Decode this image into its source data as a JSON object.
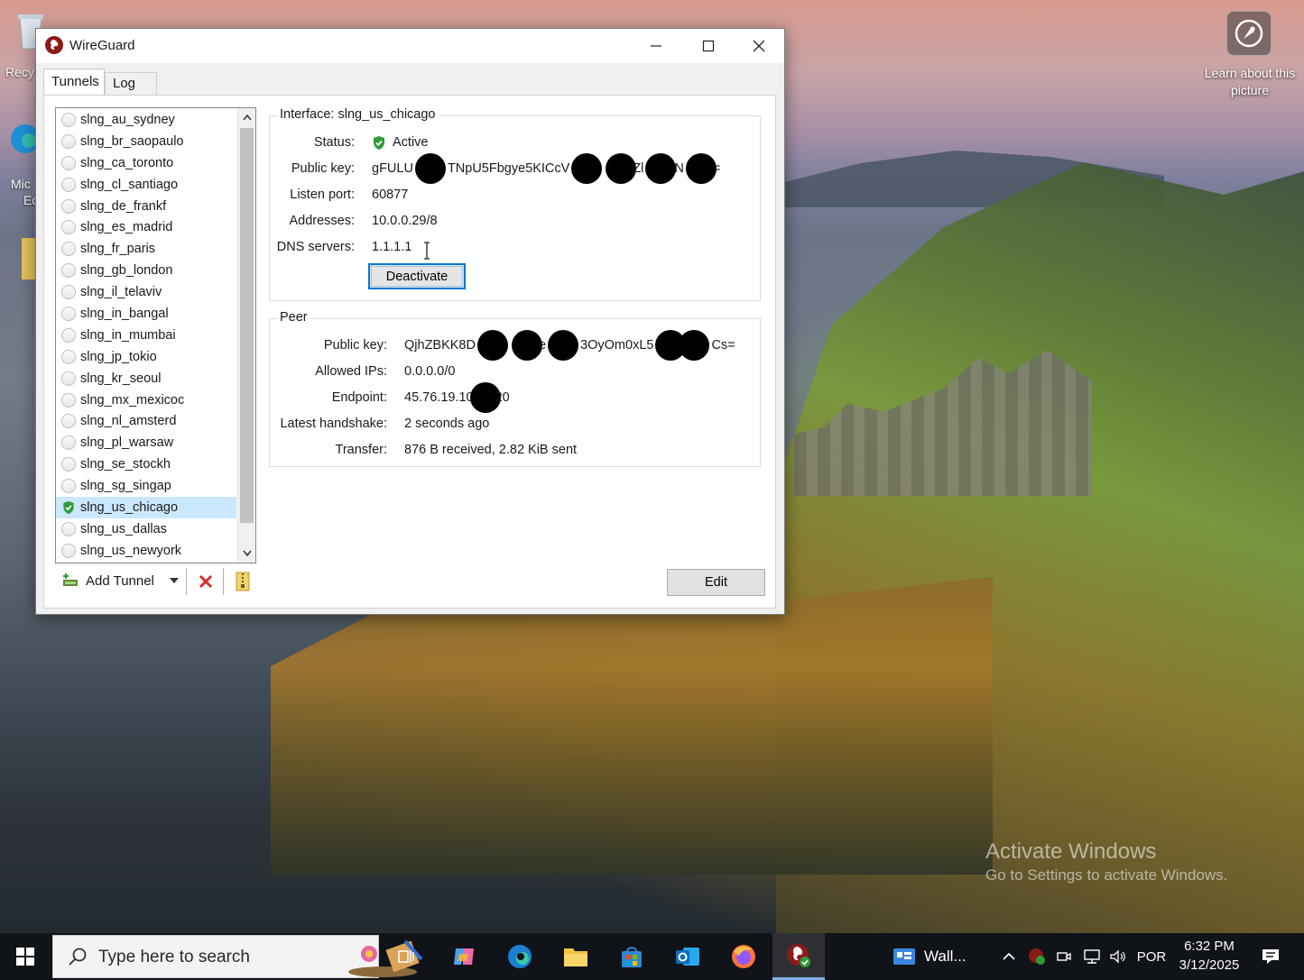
{
  "desktop": {
    "recycle_label": "Recy",
    "edge_label_1": "Mic",
    "edge_label_2": "Ed",
    "learn_about_label": "Learn about this picture",
    "activate_title": "Activate Windows",
    "activate_subtitle": "Go to Settings to activate Windows."
  },
  "window": {
    "title": "WireGuard",
    "tabs": [
      {
        "label": "Tunnels",
        "active": true
      },
      {
        "label": "Log",
        "active": false
      }
    ]
  },
  "tunnels": [
    {
      "name": "slng_au_sydney",
      "active": false
    },
    {
      "name": "slng_br_saopaulo",
      "active": false
    },
    {
      "name": "slng_ca_toronto",
      "active": false
    },
    {
      "name": "slng_cl_santiago",
      "active": false
    },
    {
      "name": "slng_de_frankf",
      "active": false
    },
    {
      "name": "slng_es_madrid",
      "active": false
    },
    {
      "name": "slng_fr_paris",
      "active": false
    },
    {
      "name": "slng_gb_london",
      "active": false
    },
    {
      "name": "slng_il_telaviv",
      "active": false
    },
    {
      "name": "slng_in_bangal",
      "active": false
    },
    {
      "name": "slng_in_mumbai",
      "active": false
    },
    {
      "name": "slng_jp_tokio",
      "active": false
    },
    {
      "name": "slng_kr_seoul",
      "active": false
    },
    {
      "name": "slng_mx_mexicoc",
      "active": false
    },
    {
      "name": "slng_nl_amsterd",
      "active": false
    },
    {
      "name": "slng_pl_warsaw",
      "active": false
    },
    {
      "name": "slng_se_stockh",
      "active": false
    },
    {
      "name": "slng_sg_singap",
      "active": false
    },
    {
      "name": "slng_us_chicago",
      "active": true
    },
    {
      "name": "slng_us_dallas",
      "active": false
    },
    {
      "name": "slng_us_newyork",
      "active": false
    }
  ],
  "toolbar": {
    "add_tunnel_label": "Add Tunnel"
  },
  "interface": {
    "group_title": "Interface: slng_us_chicago",
    "status_label": "Status:",
    "status_value": "Active",
    "public_key_label": "Public key:",
    "public_key_parts": [
      "gFULU",
      "TNpU5Fbgye5KICcV",
      "",
      "",
      "Zl",
      "N",
      "="
    ],
    "listen_port_label": "Listen port:",
    "listen_port_value": "60877",
    "addresses_label": "Addresses:",
    "addresses_value": "10.0.0.29/8",
    "dns_label": "DNS servers:",
    "dns_value": "1.1.1.1",
    "deactivate_label": "Deactivate"
  },
  "peer": {
    "group_title": "Peer",
    "public_key_label": "Public key:",
    "public_key_parts": [
      "QjhZBKK8D",
      "",
      "e",
      "3OyOm0xL5",
      "",
      "Cs="
    ],
    "allowed_ips_label": "Allowed IPs:",
    "allowed_ips_value": "0.0.0.0/0",
    "endpoint_label": "Endpoint:",
    "endpoint_parts": [
      "45.76.19.10",
      "20"
    ],
    "handshake_label": "Latest handshake:",
    "handshake_value": "2 seconds ago",
    "transfer_label": "Transfer:",
    "transfer_value": "876 B received, 2.82 KiB sent"
  },
  "edit_label": "Edit",
  "taskbar": {
    "search_placeholder": "Type here to search",
    "wall_label": "Wall...",
    "language": "POR",
    "time": "6:32 PM",
    "date": "3/12/2025"
  },
  "colors": {
    "accent": "#0078d7",
    "active_green": "#2e9c3a",
    "delete_red": "#d32f2f",
    "selected_row": "#cce8ff"
  }
}
